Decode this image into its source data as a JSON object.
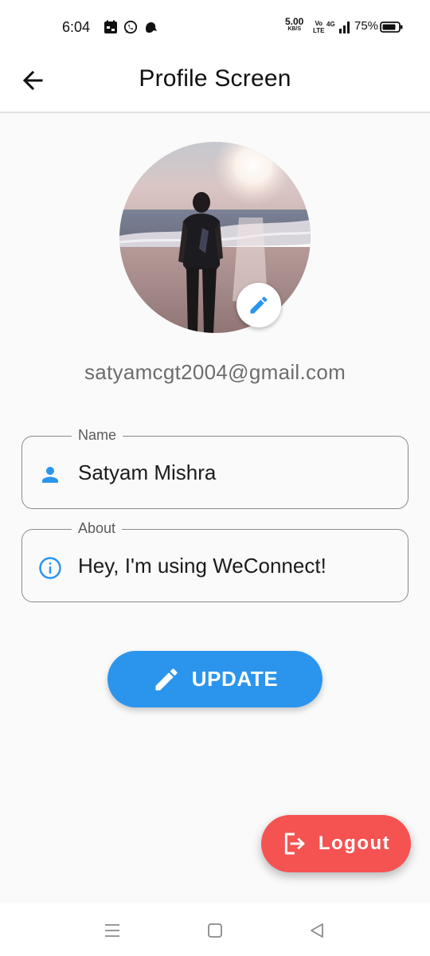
{
  "status_bar": {
    "time": "6:04",
    "net_speed_value": "5.00",
    "net_speed_unit": "KB/S",
    "volte_top": "Vo",
    "volte_bottom": "LTE",
    "network": "4G",
    "battery_percent": "75%",
    "notification_icons": [
      "calendar-icon",
      "whatsapp-icon",
      "notification-app-icon"
    ]
  },
  "app_bar": {
    "title": "Profile Screen",
    "back_icon": "arrow-left-icon"
  },
  "profile": {
    "email": "satyamcgt2004@gmail.com",
    "avatar_edit_icon": "pencil-icon"
  },
  "fields": {
    "name": {
      "label": "Name",
      "value": "Satyam Mishra",
      "icon": "person-icon"
    },
    "about": {
      "label": "About",
      "value": "Hey, I'm using WeConnect!",
      "icon": "info-icon"
    }
  },
  "buttons": {
    "update_label": "UPDATE",
    "update_icon": "pencil-icon",
    "logout_label": "Logout",
    "logout_icon": "logout-icon"
  },
  "colors": {
    "primary": "#2b95ee",
    "logout": "#f55252",
    "background": "#fafafa"
  },
  "nav_bar": {
    "buttons": [
      "menu-icon",
      "home-square-icon",
      "back-triangle-icon"
    ]
  }
}
